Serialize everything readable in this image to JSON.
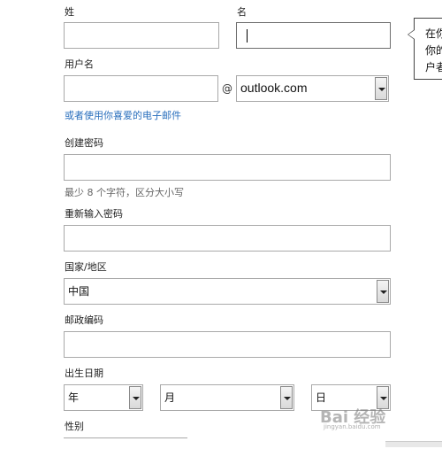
{
  "form": {
    "last_name_label": "姓",
    "first_name_label": "名",
    "username_label": "用户名",
    "at_sign": "@",
    "domain_value": "outlook.com",
    "alt_email_link": "或者使用你喜爱的电子邮件",
    "password_label": "创建密码",
    "password_hint": "最少 8 个字符，区分大小写",
    "reenter_password_label": "重新输入密码",
    "country_label": "国家/地区",
    "country_value": "中国",
    "postal_code_label": "邮政编码",
    "birthdate_label": "出生日期",
    "year_value": "年",
    "month_value": "月",
    "day_value": "日",
    "gender_label": "性别"
  },
  "tooltip": {
    "line1": "在你",
    "line2": "你的",
    "line3": "户者"
  },
  "watermark": {
    "text": "Bai 经验",
    "sub": "jingyan.baidu.com"
  }
}
